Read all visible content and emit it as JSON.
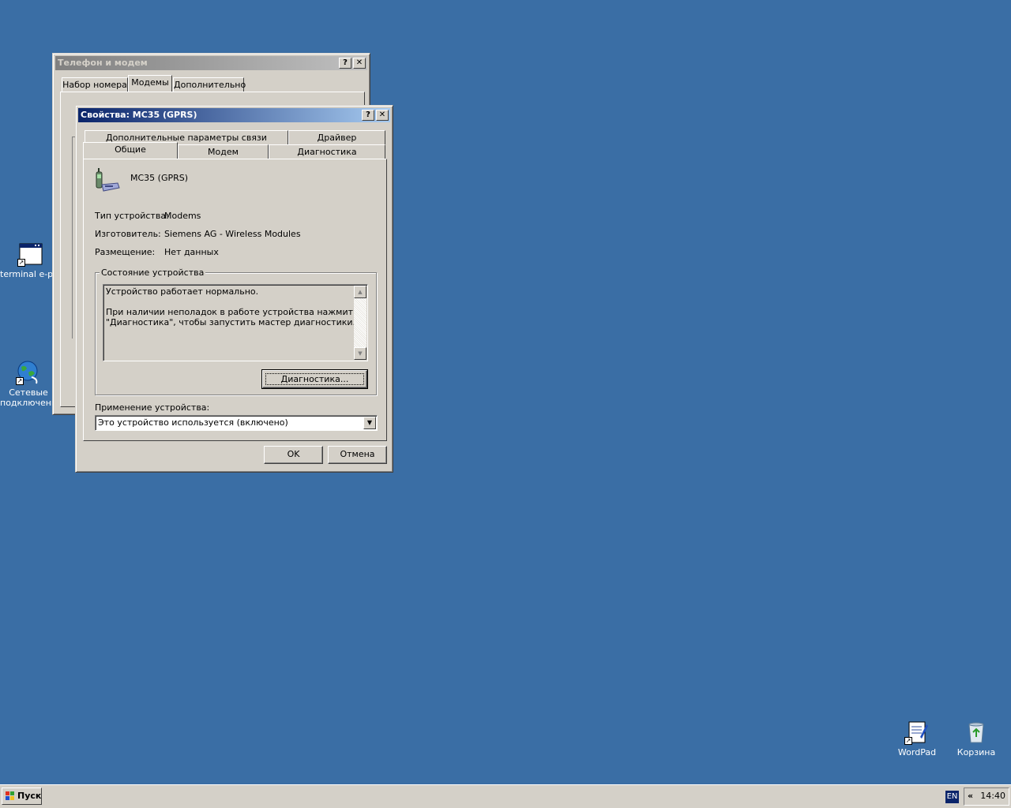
{
  "desktop": {
    "icons": [
      {
        "label": "terminal e-port"
      },
      {
        "label": "Сетевые подключения"
      },
      {
        "label": "WordPad"
      },
      {
        "label": "Корзина"
      }
    ]
  },
  "phone_window": {
    "title": "Телефон и модем",
    "tabs": [
      "Набор номера",
      "Модемы",
      "Дополнительно"
    ]
  },
  "props_window": {
    "title": "Свойства: MC35 (GPRS)",
    "tabs_row_back": [
      "Дополнительные параметры связи",
      "Драйвер"
    ],
    "tabs_row_front": [
      "Общие",
      "Модем",
      "Диагностика"
    ],
    "device_name": "MC35 (GPRS)",
    "fields": {
      "type_label": "Тип устройства:",
      "type_value": "Modems",
      "maker_label": "Изготовитель:",
      "maker_value": "Siemens AG - Wireless Modules",
      "location_label": "Размещение:",
      "location_value": "Нет данных"
    },
    "status_group_title": "Состояние устройства",
    "status_line1": "Устройство работает нормально.",
    "status_line2": "При наличии неполадок в работе устройства нажмите кнопку",
    "status_line3": "\"Диагностика\", чтобы запустить мастер диагностики.",
    "diag_button": "Диагностика...",
    "usage_label": "Применение устройства:",
    "usage_value": "Это устройство используется (включено)",
    "ok_button": "OK",
    "cancel_button": "Отмена"
  },
  "taskbar": {
    "start_label": "Пуск",
    "lang": "EN",
    "clock": "14:40",
    "tray_toggle": "«"
  },
  "colors": {
    "desktop": "#3a6ea5",
    "active_title": "#0a246a",
    "face": "#d4d0c8"
  }
}
